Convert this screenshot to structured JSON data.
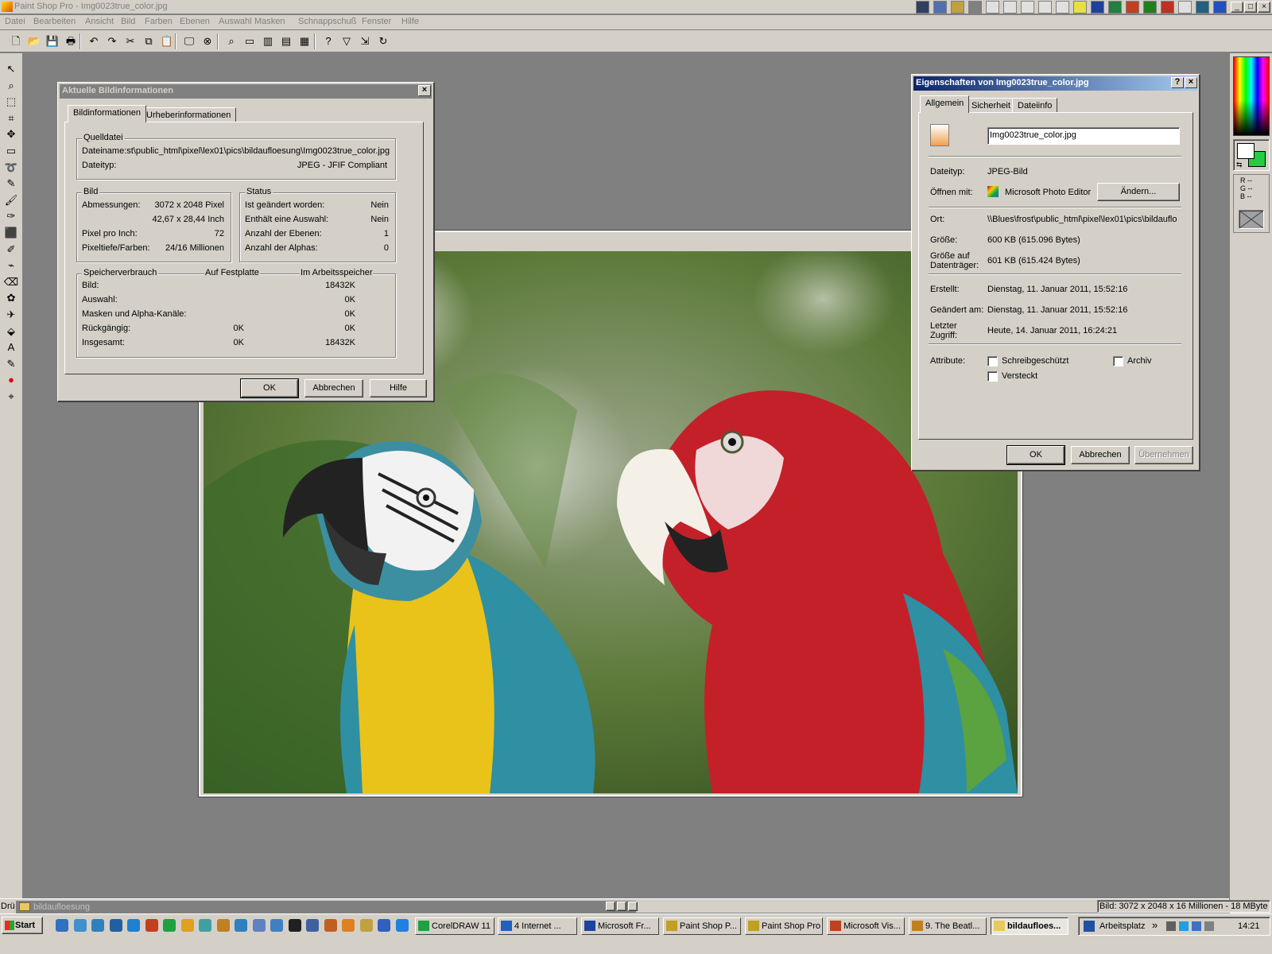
{
  "app": {
    "title": "Paint Shop Pro - Img0023true_color.jpg",
    "window_buttons": [
      "_",
      "□",
      "×"
    ]
  },
  "menu": [
    "Datei",
    "Bearbeiten",
    "Ansicht",
    "Bild",
    "Farben",
    "Ebenen",
    "Auswahl",
    "Masken",
    "Schnappschuß",
    "Fenster",
    "Hilfe"
  ],
  "toolbar_icons": [
    "new-icon",
    "open-icon",
    "save-icon",
    "print-icon",
    "undo-icon",
    "redo-icon",
    "cut-icon",
    "copy-icon",
    "paste-icon",
    "screen-icon",
    "browse-icon",
    "zoom-icon",
    "overview-icon",
    "histogram-icon",
    "layers-icon",
    "palette-icon",
    "help-pointer-icon",
    "filter-icon",
    "transform-icon",
    "refresh-icon"
  ],
  "tools": [
    "pointer-icon",
    "zoom-icon",
    "deform-icon",
    "crop-icon",
    "move-icon",
    "selection-icon",
    "lasso-icon",
    "dropper-icon",
    "brush-icon",
    "clone-icon",
    "color-replace-icon",
    "retouch-icon",
    "scratch-icon",
    "eraser-icon",
    "picture-tube-icon",
    "airbrush-icon",
    "fill-icon",
    "text-icon",
    "draw-icon",
    "shape-icon",
    "vector-icon"
  ],
  "colors": {
    "titlebar_active_start": "#0a246a",
    "titlebar_active_end": "#a6caf0",
    "face": "#d4d0c8",
    "workspace": "#808080",
    "background_swatch": "#22cc44"
  },
  "palette": {
    "rgb_labels": [
      "R --",
      "G --",
      "B --"
    ]
  },
  "bildinfo_dialog": {
    "title": "Aktuelle Bildinformationen",
    "tabs": [
      "Bildinformationen",
      "Urheberinformationen"
    ],
    "quelldatei": {
      "legend": "Quelldatei",
      "dateiname": "Dateiname:st\\public_html\\pixel\\lex01\\pics\\bildaufloesung\\Img0023true_color.jpg",
      "dateityp_label": "Dateityp:",
      "dateityp_value": "JPEG - JFIF Compliant"
    },
    "bild": {
      "legend": "Bild",
      "rows": [
        {
          "label": "Abmessungen:",
          "value": "3072 x 2048 Pixel"
        },
        {
          "label": "",
          "value": "42,67 x 28,44 Inch"
        },
        {
          "label": "Pixel pro Inch:",
          "value": "72"
        },
        {
          "label": "Pixeltiefe/Farben:",
          "value": "24/16 Millionen"
        }
      ]
    },
    "status": {
      "legend": "Status",
      "rows": [
        {
          "label": "Ist geändert worden:",
          "value": "Nein"
        },
        {
          "label": "Enthält eine Auswahl:",
          "value": "Nein"
        },
        {
          "label": "Anzahl der Ebenen:",
          "value": "1"
        },
        {
          "label": "Anzahl der Alphas:",
          "value": "0"
        }
      ]
    },
    "speicher": {
      "legend": "Speicherverbrauch",
      "col_disk": "Auf Festplatte",
      "col_mem": "Im Arbeitsspeicher",
      "rows": [
        {
          "label": "Bild:",
          "disk": "",
          "mem": "18432K"
        },
        {
          "label": "Auswahl:",
          "disk": "",
          "mem": "0K"
        },
        {
          "label": "Masken und Alpha-Kanäle:",
          "disk": "",
          "mem": "0K"
        },
        {
          "label": "Rückgängig:",
          "disk": "0K",
          "mem": "0K"
        },
        {
          "label": "Insgesamt:",
          "disk": "0K",
          "mem": "18432K"
        }
      ]
    },
    "buttons": {
      "ok": "OK",
      "cancel": "Abbrechen",
      "help": "Hilfe"
    }
  },
  "props_dialog": {
    "title": "Eigenschaften von Img0023true_color.jpg",
    "help_btn": "?",
    "tabs": [
      "Allgemein",
      "Sicherheit",
      "Dateiinfo"
    ],
    "filename": "Img0023true_color.jpg",
    "rows": [
      {
        "label": "Dateityp:",
        "value": "JPEG-Bild"
      },
      {
        "label": "Öffnen mit:",
        "value": "Microsoft Photo Editor"
      },
      {
        "label": "Ort:",
        "value": "\\\\Blues\\frost\\public_html\\pixel\\lex01\\pics\\bildauflo"
      },
      {
        "label": "Größe:",
        "value": "600 KB (615.096 Bytes)"
      },
      {
        "label": "Größe auf Datenträger:",
        "value": "601 KB (615.424 Bytes)"
      },
      {
        "label": "Erstellt:",
        "value": "Dienstag, 11. Januar 2011, 15:52:16"
      },
      {
        "label": "Geändert am:",
        "value": "Dienstag, 11. Januar 2011, 15:52:16"
      },
      {
        "label": "Letzter Zugriff:",
        "value": "Heute, 14. Januar 2011, 16:24:21"
      }
    ],
    "change_btn": "Ändern...",
    "attribute_label": "Attribute:",
    "attributes": [
      {
        "label": "Schreibgeschützt",
        "checked": false
      },
      {
        "label": "Archiv",
        "checked": false
      },
      {
        "label": "Versteckt",
        "checked": false
      }
    ],
    "buttons": {
      "ok": "OK",
      "cancel": "Abbrechen",
      "apply": "Übernehmen"
    }
  },
  "mdi": {
    "minimized_window": "bildaufloesung",
    "label": "Drü"
  },
  "status_text": "Bild:  3072 x 2048 x 16 Millionen - 18 MByte",
  "taskbar": {
    "start": "Start",
    "tasks": [
      {
        "label": "CorelDRAW 11",
        "active": false
      },
      {
        "label": "4 Internet ...",
        "active": false
      },
      {
        "label": "Microsoft Fr...",
        "active": false
      },
      {
        "label": "Paint Shop P...",
        "active": false
      },
      {
        "label": "Paint Shop Pro",
        "active": false
      },
      {
        "label": "Microsoft Vis...",
        "active": false
      },
      {
        "label": "9. The Beatl...",
        "active": false
      },
      {
        "label": "bildaufloes...",
        "active": true
      }
    ],
    "desk_label": "Arbeitsplatz",
    "clock": "14:21"
  }
}
